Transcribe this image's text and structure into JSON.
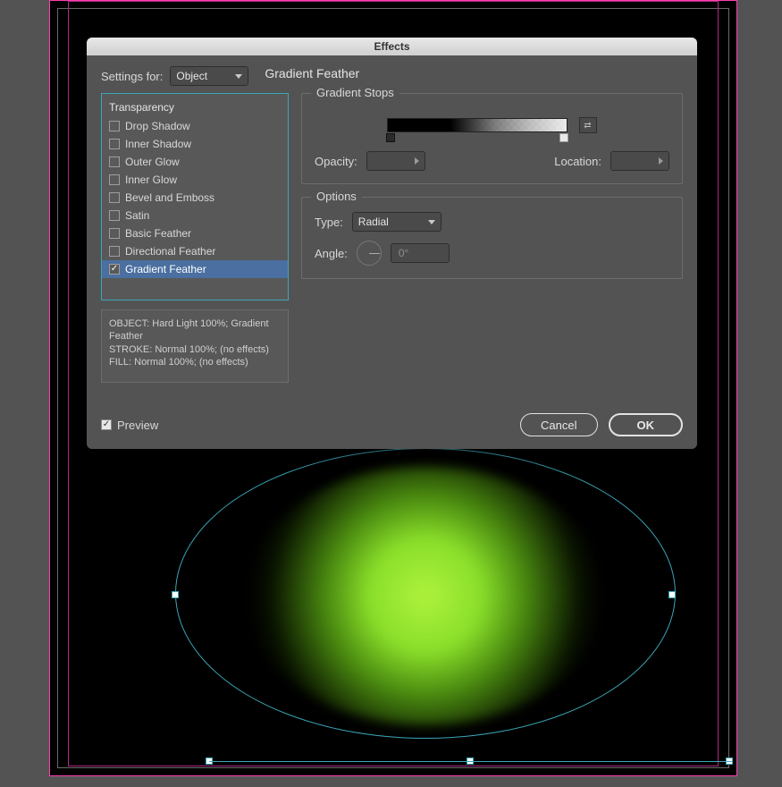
{
  "dialog": {
    "title": "Effects",
    "settings_for_label": "Settings for:",
    "settings_for_value": "Object",
    "panel_heading": "Gradient Feather",
    "gradient_stops": {
      "legend": "Gradient Stops",
      "opacity_label": "Opacity:",
      "opacity_value": "",
      "location_label": "Location:",
      "location_value": ""
    },
    "options": {
      "legend": "Options",
      "type_label": "Type:",
      "type_value": "Radial",
      "angle_label": "Angle:",
      "angle_value": "0°"
    },
    "effects_list": {
      "header": "Transparency",
      "items": [
        {
          "label": "Drop Shadow",
          "checked": false,
          "selected": false
        },
        {
          "label": "Inner Shadow",
          "checked": false,
          "selected": false
        },
        {
          "label": "Outer Glow",
          "checked": false,
          "selected": false
        },
        {
          "label": "Inner Glow",
          "checked": false,
          "selected": false
        },
        {
          "label": "Bevel and Emboss",
          "checked": false,
          "selected": false
        },
        {
          "label": "Satin",
          "checked": false,
          "selected": false
        },
        {
          "label": "Basic Feather",
          "checked": false,
          "selected": false
        },
        {
          "label": "Directional Feather",
          "checked": false,
          "selected": false
        },
        {
          "label": "Gradient Feather",
          "checked": true,
          "selected": true
        }
      ]
    },
    "summary": {
      "line1": "OBJECT: Hard Light 100%; Gradient Feather",
      "line2": "STROKE: Normal 100%; (no effects)",
      "line3": "FILL: Normal 100%; (no effects)"
    },
    "preview_label": "Preview",
    "preview_checked": true,
    "cancel_label": "Cancel",
    "ok_label": "OK"
  }
}
